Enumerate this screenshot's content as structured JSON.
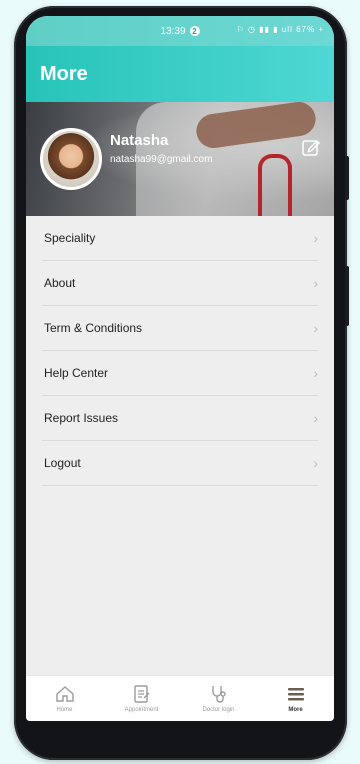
{
  "status": {
    "time": "13:39",
    "badge": "2",
    "icons": "⚐ ◷ ▮▮ ▮ ull 67% +"
  },
  "header": {
    "title": "More"
  },
  "profile": {
    "name": "Natasha",
    "email": "natasha99@gmail.com"
  },
  "menu": {
    "items": [
      {
        "label": "Speciality"
      },
      {
        "label": "About"
      },
      {
        "label": "Term & Conditions"
      },
      {
        "label": "Help Center"
      },
      {
        "label": "Report Issues"
      },
      {
        "label": "Logout"
      }
    ]
  },
  "nav": {
    "items": [
      {
        "label": "Home",
        "icon": "home-icon"
      },
      {
        "label": "Appointment",
        "icon": "document-icon"
      },
      {
        "label": "Doctor login",
        "icon": "stethoscope-icon"
      },
      {
        "label": "More",
        "icon": "menu-icon"
      }
    ]
  },
  "colors": {
    "accent": "#27c4b8",
    "accent_light": "#4fd7d4",
    "menu_bg": "#eeeeee"
  }
}
